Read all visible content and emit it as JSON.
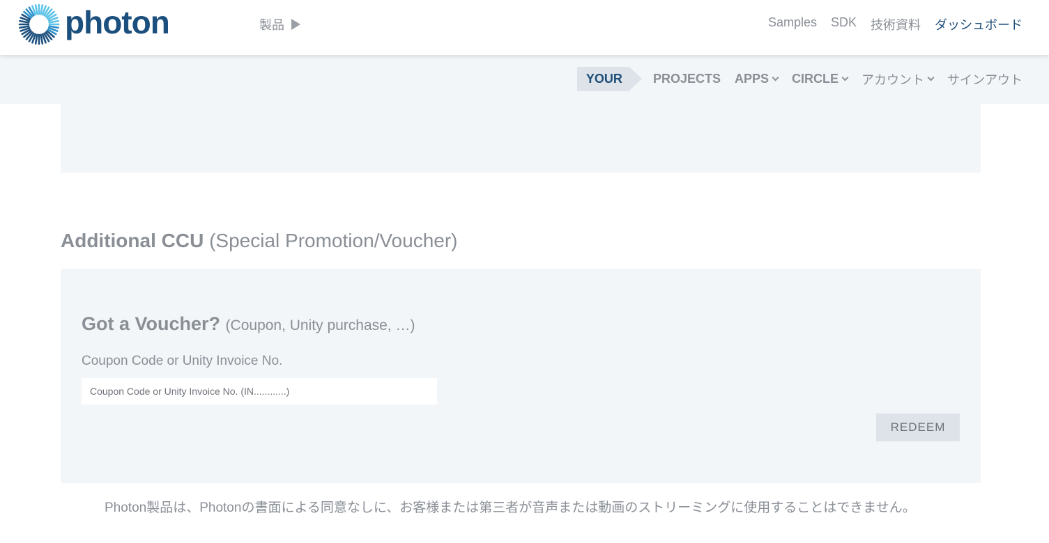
{
  "header": {
    "logo_text": "photon",
    "products_label": "製品",
    "nav": [
      {
        "label": "Samples"
      },
      {
        "label": "SDK"
      },
      {
        "label": "技術資料"
      },
      {
        "label": "ダッシュボード"
      }
    ]
  },
  "subnav": {
    "your": "YOUR",
    "projects": "PROJECTS",
    "apps": "APPS",
    "circle": "CIRCLE",
    "account": "アカウント",
    "signout": "サインアウト"
  },
  "ccu": {
    "title_bold": "Additional CCU",
    "title_sub": "(Special Promotion/Voucher)"
  },
  "voucher": {
    "title_bold": "Got a Voucher?",
    "title_sub": "(Coupon, Unity purchase, …)",
    "field_label": "Coupon Code or Unity Invoice No.",
    "field_placeholder": "Coupon Code or Unity Invoice No. (IN............)",
    "field_value": "",
    "redeem_label": "REDEEM"
  },
  "footer": {
    "note": "Photon製品は、Photonの書面による同意なしに、お客様または第三者が音声または動画のストリーミングに使用することはできません。"
  },
  "colors": {
    "brand": "#1b4f7d",
    "panel_bg": "#f3f6f9",
    "text_muted": "#8a8f96",
    "button_bg": "#dde3e8"
  }
}
